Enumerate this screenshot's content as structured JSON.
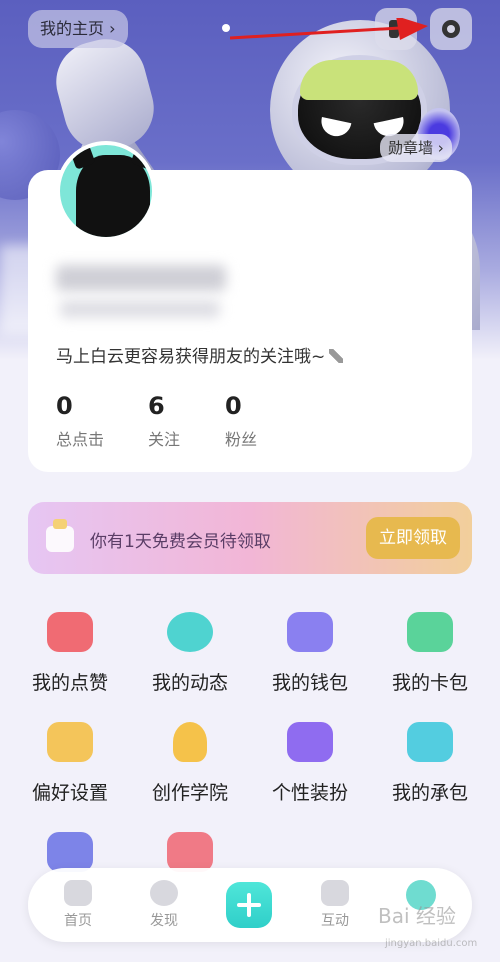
{
  "header": {
    "home_link": "我的主页 ›",
    "medal_wall": "勋章墙 ›"
  },
  "profile": {
    "bio": "马上白云更容易获得朋友的关注哦~",
    "stats": [
      {
        "value": "0",
        "label": "总点击"
      },
      {
        "value": "6",
        "label": "关注"
      },
      {
        "value": "0",
        "label": "粉丝"
      }
    ]
  },
  "vip_banner": {
    "text": "你有1天免费会员待领取",
    "button": "立即领取"
  },
  "menu": [
    {
      "label": "我的点赞",
      "icon": "heart-icon",
      "color": "#f06b73"
    },
    {
      "label": "我的动态",
      "icon": "leaf-icon",
      "color": "#4fd3d0"
    },
    {
      "label": "我的钱包",
      "icon": "wallet-icon",
      "color": "#8a80f0"
    },
    {
      "label": "我的卡包",
      "icon": "card-icon",
      "color": "#5ad39a"
    },
    {
      "label": "偏好设置",
      "icon": "heart-badge-icon",
      "color": "#f4c55a"
    },
    {
      "label": "创作学院",
      "icon": "lightbulb-icon",
      "color": "#f5c24a"
    },
    {
      "label": "个性装扮",
      "icon": "shop-icon",
      "color": "#8f6cf0"
    },
    {
      "label": "我的承包",
      "icon": "fish-icon",
      "color": "#53cde0"
    },
    {
      "label": "",
      "icon": "cards-icon",
      "color": "#7d84e8"
    },
    {
      "label": "",
      "icon": "gift-bag-icon",
      "color": "#f07a86"
    }
  ],
  "nav": {
    "home": "首页",
    "discover": "发现",
    "interact": "互动"
  },
  "watermark": {
    "brand": "Bai 经验",
    "url": "jingyan.baidu.com"
  }
}
